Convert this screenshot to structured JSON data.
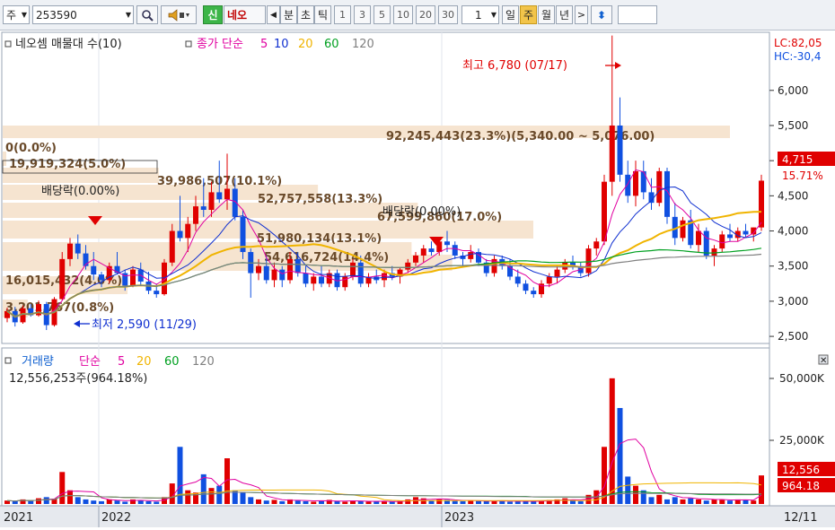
{
  "toolbar": {
    "market": "주",
    "code": "253590",
    "new_badge": "신",
    "stock_name": "네오",
    "min_label": "분",
    "sec_label": "초",
    "tick_label": "틱",
    "periods": [
      "1",
      "3",
      "5",
      "10",
      "20",
      "30"
    ],
    "count": "1",
    "day_label": "일",
    "week_label": "주",
    "month_label": "월",
    "year_label": "년"
  },
  "price_panel": {
    "title": "네오셈 매물대 수(10)",
    "ma_label": "종가 단순",
    "ma_periods": [
      "5",
      "10",
      "20",
      "60",
      "120"
    ],
    "ma_colors": [
      "#e000a0",
      "#1030d0",
      "#f0b400",
      "#00a020",
      "#808080"
    ],
    "y_ticks": [
      "6,000",
      "5,500",
      "5,000",
      "4,500",
      "4,000",
      "3,500",
      "3,000",
      "2,500"
    ],
    "lc_label": "LC:82,05",
    "hc_label": "HC:-30,4",
    "current_price": "4,715",
    "current_change": "15.71%",
    "high_annotation": "최고 6,780 (07/17)",
    "low_annotation": "최저 2,590 (11/29)",
    "dividend_1": "배당락(0.00%)",
    "dividend_2": "배당락(0.00%)"
  },
  "volume_profile": [
    {
      "label": "92,245,443(23.3%)(5,340.00 ~ 5,076.00)"
    },
    {
      "label": "0(0.0%)"
    },
    {
      "label": "19,919,324(5.0%)"
    },
    {
      "label": "39,986,507(10.1%)"
    },
    {
      "label": "52,757,558(13.3%)"
    },
    {
      "label": "67,599,860(17.0%)"
    },
    {
      "label": "51,980,134(13.1%)"
    },
    {
      "label": "54,616,724(14.4%)"
    },
    {
      "label": "16,015,432(4.0%)"
    },
    {
      "label": "3,201,767(0.8%)"
    }
  ],
  "volume_panel": {
    "title": "거래량",
    "ma_label": "단순",
    "ma_periods": [
      "5",
      "20",
      "60",
      "120"
    ],
    "info": "12,556,253주(964.18%)",
    "y_ticks": [
      "50,000K",
      "25,000K"
    ],
    "current_volume": "12,556",
    "current_ratio": "964.18"
  },
  "x_axis": {
    "labels": [
      "2021",
      "2022",
      "2023",
      "12/11"
    ]
  },
  "chart_data": {
    "type": "candlestick",
    "period": "weekly",
    "y_range": [
      2450,
      6750
    ],
    "candles": [
      [
        2760,
        2910,
        2700,
        2860
      ],
      [
        2860,
        2920,
        2640,
        2700
      ],
      [
        2700,
        2940,
        2680,
        2900
      ],
      [
        2900,
        2960,
        2780,
        2800
      ],
      [
        2800,
        3010,
        2780,
        2960
      ],
      [
        2960,
        2990,
        2590,
        2660
      ],
      [
        2660,
        3060,
        2640,
        3030
      ],
      [
        3030,
        3700,
        3020,
        3600
      ],
      [
        3600,
        3900,
        3500,
        3820
      ],
      [
        3820,
        3950,
        3600,
        3680
      ],
      [
        3680,
        3800,
        3450,
        3500
      ],
      [
        3500,
        3700,
        3300,
        3380
      ],
      [
        3380,
        3420,
        3200,
        3300
      ],
      [
        3300,
        3550,
        3250,
        3500
      ],
      [
        3500,
        3700,
        3380,
        3400
      ],
      [
        3400,
        3450,
        3150,
        3220
      ],
      [
        3220,
        3500,
        3200,
        3450
      ],
      [
        3450,
        3550,
        3220,
        3280
      ],
      [
        3280,
        3420,
        3100,
        3150
      ],
      [
        3150,
        3250,
        3050,
        3100
      ],
      [
        3100,
        3600,
        3080,
        3550
      ],
      [
        3550,
        4100,
        3500,
        4000
      ],
      [
        4000,
        4500,
        3850,
        3900
      ],
      [
        3900,
        4200,
        3700,
        4100
      ],
      [
        4100,
        4500,
        4000,
        4350
      ],
      [
        4350,
        4750,
        4200,
        4300
      ],
      [
        4300,
        4700,
        4200,
        4550
      ],
      [
        4550,
        5000,
        4400,
        4450
      ],
      [
        4450,
        5100,
        4300,
        4600
      ],
      [
        4600,
        4750,
        4150,
        4200
      ],
      [
        4200,
        4300,
        3600,
        3700
      ],
      [
        3700,
        3750,
        3050,
        3400
      ],
      [
        3400,
        3600,
        3300,
        3500
      ],
      [
        3500,
        3650,
        3250,
        3300
      ],
      [
        3300,
        3550,
        3200,
        3450
      ],
      [
        3450,
        3500,
        3200,
        3300
      ],
      [
        3300,
        3700,
        3250,
        3600
      ],
      [
        3600,
        3700,
        3350,
        3400
      ],
      [
        3400,
        3500,
        3200,
        3250
      ],
      [
        3250,
        3400,
        3150,
        3350
      ],
      [
        3350,
        3500,
        3200,
        3250
      ],
      [
        3250,
        3450,
        3200,
        3400
      ],
      [
        3400,
        3450,
        3150,
        3200
      ],
      [
        3200,
        3400,
        3150,
        3350
      ],
      [
        3350,
        3600,
        3300,
        3550
      ],
      [
        3550,
        3650,
        3200,
        3250
      ],
      [
        3250,
        3400,
        3200,
        3350
      ],
      [
        3350,
        3450,
        3250,
        3300
      ],
      [
        3300,
        3450,
        3200,
        3400
      ],
      [
        3400,
        3500,
        3300,
        3350
      ],
      [
        3350,
        3480,
        3250,
        3450
      ],
      [
        3450,
        3600,
        3400,
        3550
      ],
      [
        3550,
        3700,
        3500,
        3650
      ],
      [
        3650,
        3800,
        3550,
        3750
      ],
      [
        3750,
        3850,
        3650,
        3700
      ],
      [
        3700,
        3900,
        3650,
        3850
      ],
      [
        3850,
        4000,
        3700,
        3800
      ],
      [
        3800,
        3850,
        3600,
        3650
      ],
      [
        3650,
        3700,
        3500,
        3600
      ],
      [
        3600,
        3800,
        3550,
        3700
      ],
      [
        3700,
        3750,
        3500,
        3550
      ],
      [
        3550,
        3600,
        3350,
        3400
      ],
      [
        3400,
        3650,
        3350,
        3600
      ],
      [
        3600,
        3650,
        3450,
        3500
      ],
      [
        3500,
        3600,
        3300,
        3350
      ],
      [
        3350,
        3450,
        3200,
        3250
      ],
      [
        3250,
        3300,
        3100,
        3150
      ],
      [
        3150,
        3200,
        3050,
        3100
      ],
      [
        3100,
        3300,
        3050,
        3250
      ],
      [
        3250,
        3400,
        3200,
        3350
      ],
      [
        3350,
        3500,
        3250,
        3450
      ],
      [
        3450,
        3600,
        3400,
        3550
      ],
      [
        3550,
        3650,
        3450,
        3500
      ],
      [
        3500,
        3550,
        3350,
        3400
      ],
      [
        3400,
        3800,
        3350,
        3750
      ],
      [
        3750,
        3900,
        3650,
        3850
      ],
      [
        3850,
        4800,
        3800,
        4700
      ],
      [
        4700,
        6780,
        4500,
        5500
      ],
      [
        5500,
        5900,
        4700,
        4800
      ],
      [
        4800,
        5000,
        4400,
        4500
      ],
      [
        4500,
        5000,
        4350,
        4850
      ],
      [
        4850,
        5000,
        4450,
        4550
      ],
      [
        4550,
        4750,
        4300,
        4400
      ],
      [
        4400,
        4900,
        4350,
        4850
      ],
      [
        4850,
        4900,
        4100,
        4200
      ],
      [
        4200,
        4400,
        3800,
        3900
      ],
      [
        3900,
        4200,
        3850,
        4150
      ],
      [
        4150,
        4300,
        3750,
        3800
      ],
      [
        3800,
        4100,
        3700,
        4000
      ],
      [
        4000,
        4050,
        3600,
        3650
      ],
      [
        3650,
        3800,
        3500,
        3750
      ],
      [
        3750,
        4000,
        3700,
        3950
      ],
      [
        3950,
        4100,
        3850,
        3900
      ],
      [
        3900,
        4050,
        3850,
        4000
      ],
      [
        4000,
        4100,
        3900,
        3950
      ],
      [
        3950,
        4050,
        3850,
        4050
      ],
      [
        4050,
        4800,
        4000,
        4715
      ]
    ],
    "volumes": [
      1.5,
      1.2,
      2,
      1.3,
      2.5,
      3,
      2.2,
      14,
      6,
      3,
      2,
      1.5,
      1.2,
      2,
      1.5,
      1,
      2,
      1.5,
      1.2,
      1,
      3,
      9,
      25,
      6,
      5,
      13,
      7,
      8,
      20,
      6,
      5,
      3,
      2,
      1.5,
      1.8,
      1.2,
      2,
      1.5,
      1.2,
      1,
      1.3,
      1.8,
      1.2,
      1,
      1.5,
      1.2,
      1,
      1.1,
      1.2,
      1,
      1.3,
      2,
      3,
      2.5,
      1.5,
      2,
      1.8,
      1.3,
      1.2,
      1.5,
      1.3,
      1.2,
      1.5,
      1.2,
      1,
      1.1,
      1.3,
      1.2,
      1.5,
      1.8,
      2,
      2.5,
      1.5,
      1.2,
      4,
      6,
      25,
      55,
      42,
      12,
      8,
      6,
      3,
      4,
      2,
      3,
      2,
      2.5,
      2,
      1.5,
      2,
      1.8,
      1.5,
      2,
      1.8,
      1.5,
      12.5
    ]
  }
}
